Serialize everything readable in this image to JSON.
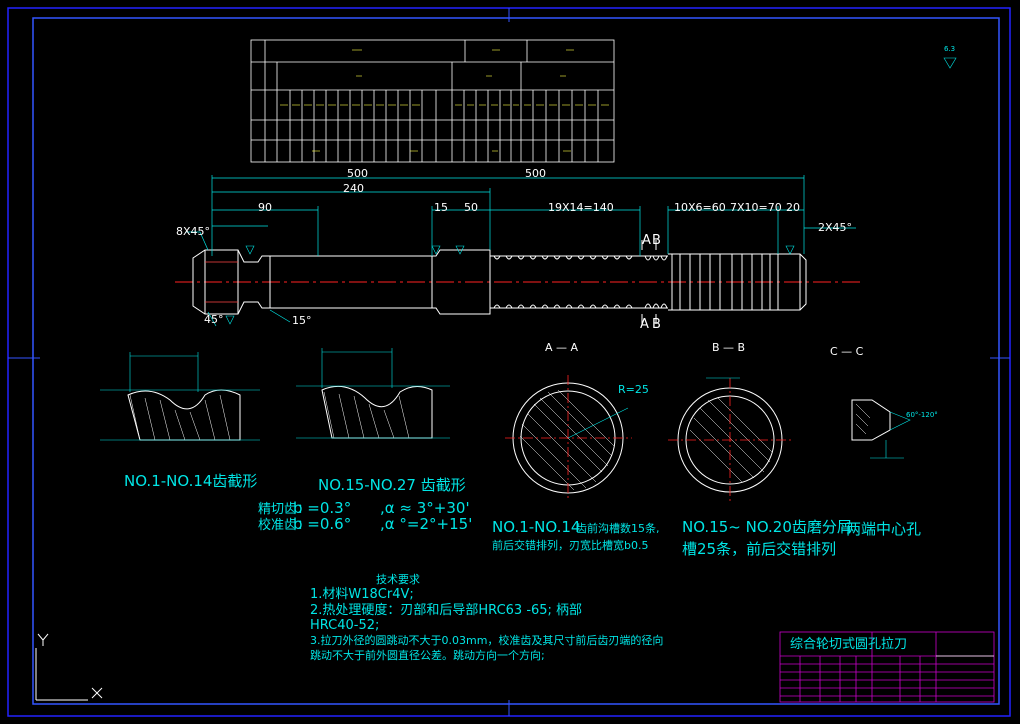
{
  "profile_labels": {
    "left": "NO.1-NO.14齿截形",
    "right": "NO.15-NO.27 齿截形"
  },
  "dims_main": {
    "overall": "500",
    "d240": "240",
    "d90": "90",
    "d15": "15",
    "d50": "50",
    "teeth1": "19X14=140",
    "teeth2": "10X6=60",
    "teeth3": "7X10=70",
    "d20": "20",
    "chamfer_left": "8X45°",
    "chamfer_right": "2X45°",
    "angle45": "45°",
    "angle15": "15°"
  },
  "tooth_params": {
    "row1_name": "精切齿：",
    "row1_b": "b   =0.3°",
    "row1_alpha": ",α ≈ 3°+30'",
    "row2_name": "校准齿：",
    "row2_b": "b   =0.6°",
    "row2_alpha": ",α °=2°+15'"
  },
  "sections": {
    "aa_title": "A — A",
    "bb_title": "B — B",
    "cc_title": "C — C",
    "aa_caption1": "NO.1-NO.14",
    "aa_caption1b": "齿前沟槽数15条,",
    "aa_caption2": "前后交错排列，刃宽比槽宽b0.5",
    "bb_caption1": "NO.15~ NO.20齿磨分屑",
    "bb_caption2": "槽25条，前后交错排列",
    "cc_caption": "两端中心孔",
    "r25": "R=25",
    "a60": "60°-120°"
  },
  "tech_req": {
    "title": "技术要求",
    "l1": "1.材料W18Cr4V;",
    "l2": "2.热处理硬度：刃部和后导部HRC63 -65; 柄部",
    "l3": "HRC40-52;",
    "l4": "3.拉刀外径的圆跳动不大于0.03mm，校准齿及其尺寸前后齿刃端的径向",
    "l5": "跳动不大于前外圆直径公差。跳动方向一个方向;"
  },
  "title_block": {
    "name": "综合轮切式圆孔拉刀"
  },
  "ucs": {
    "y": "Y",
    "x": "X"
  },
  "roughness": "6.3"
}
